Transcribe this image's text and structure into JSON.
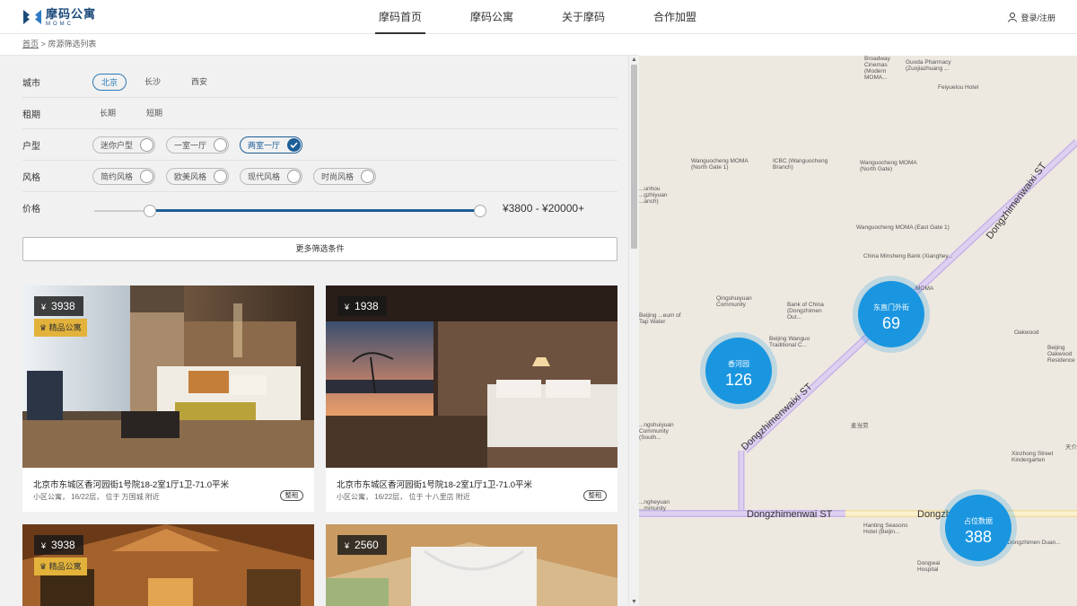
{
  "brand": {
    "name_cn": "摩码公寓",
    "name_en": "MOMC",
    "color": "#1c4a7a"
  },
  "nav": {
    "items": [
      "摩码首页",
      "摩码公寓",
      "关于摩码",
      "合作加盟"
    ],
    "active": "摩码首页"
  },
  "login": {
    "label": "登录/注册",
    "icon": "user-icon"
  },
  "breadcrumb": {
    "home": "首页",
    "separator": ">",
    "current": "房源筛选列表"
  },
  "filters": {
    "city": {
      "label": "城市",
      "options": [
        "北京",
        "长沙",
        "西安"
      ],
      "selected": "北京"
    },
    "term": {
      "label": "租期",
      "options": [
        "长期",
        "短期"
      ]
    },
    "layout": {
      "label": "户型",
      "options": [
        "迷你户型",
        "一室一厅",
        "两室一厅"
      ],
      "checked": "两室一厅"
    },
    "style": {
      "label": "风格",
      "options": [
        "简约风格",
        "欧美风格",
        "现代风格",
        "时尚风格"
      ]
    },
    "price": {
      "label": "价格",
      "range_text": "¥3800 - ¥20000+",
      "low_fraction": 0.13,
      "high_fraction": 1.0
    },
    "more_button": "更多筛选条件"
  },
  "listings": [
    {
      "price": "3938",
      "currency": "¥",
      "badge": "精品公寓",
      "title": "北京市东城区香河园街1号院18-2室1厅1卫-71.0平米",
      "subtitle": "小区公寓， 16/22层， 位于 万国城 附近",
      "tag": "整租"
    },
    {
      "price": "1938",
      "currency": "¥",
      "badge": "",
      "title": "北京市东城区香河园街1号院18-2室1厅1卫-71.0平米",
      "subtitle": "小区公寓， 16/22层， 位于 十八里店 附近",
      "tag": "整租"
    },
    {
      "price": "3938",
      "currency": "¥",
      "badge": "精品公寓",
      "title": "",
      "subtitle": "",
      "tag": ""
    },
    {
      "price": "2560",
      "currency": "¥",
      "badge": "",
      "title": "",
      "subtitle": "",
      "tag": ""
    }
  ],
  "map": {
    "background": "#ede9e1",
    "roads": {
      "diagonal": "Dongzhimenwaixi ST",
      "diagonal_lower": "Dongzhimenwaixi ST",
      "horizontal": "Dongzhimenwai ST",
      "horizontal_right": "Dongzhimenwai ST"
    },
    "labels": [
      "Broadway Cinemas (Modern MOMA...",
      "Guoda Pharmacy (Zuojiazhuang ...",
      "Feiyuelou Hotel",
      "Wanguocheng MOMA (North Gate 1)",
      "ICBC (Wanguocheng Branch)",
      "Wanguocheng MOMA (North Gate)",
      "Wanguocheng MOMA (East Gate 1)",
      "China Minsheng Bank (Xianghey...",
      "Qingshuiyuan Community",
      "Bank of China (Dongzhimen Out...",
      "Beijing ...eum of Tap Water",
      "Beijing Wanguo Traditional C...",
      "MOMA",
      "Oakwood",
      "Beijing Oakwood Residence",
      "麦当劳",
      "...ngshuiyuan Community (South...",
      "Xinzhong Street Kindergarten",
      "...ngheyuan ...mmunity",
      "Hanting Seasons Hotel (Beijin...",
      "...Dongzhimen Duan...",
      "Dongwai Hospital",
      "...unhou ...gzhiyuan ...anch)",
      "天介"
    ],
    "clusters": [
      {
        "name": "香河园",
        "count": "126"
      },
      {
        "name": "东直门外街",
        "count": "69"
      },
      {
        "name": "占位数据",
        "count": "388"
      }
    ],
    "cluster_color": "#1a96e0"
  }
}
